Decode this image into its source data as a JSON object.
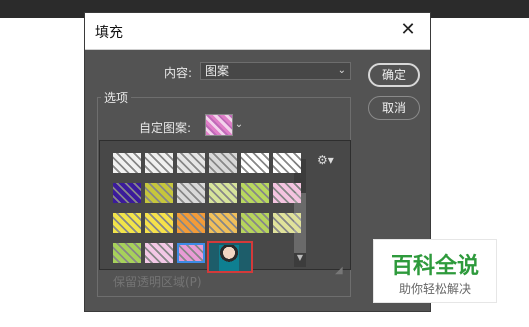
{
  "dialog": {
    "title": "填充",
    "content_label": "内容:",
    "content_value": "图案",
    "ok_label": "确定",
    "cancel_label": "取消",
    "options_title": "选项",
    "custom_pattern_label": "自定图案:",
    "bottom_hint": "保留透明区域(P)"
  },
  "icons": {
    "close": "close-icon",
    "dropdown": "chevron-down-icon",
    "gear": "gear-icon",
    "resize": "resize-grip-icon"
  },
  "patterns": {
    "rows": [
      [
        "#f2f2f2",
        "#f0f0f0",
        "#e6e6e6",
        "#d8d8d8",
        "#ffffff",
        "#ffffff"
      ],
      [
        "#3b1b9b",
        "#c6c63c",
        "#d9d9d9",
        "#d7e49b",
        "#b8d85e",
        "#f4c4e0"
      ],
      [
        "#f2e44a",
        "#f6e14b",
        "#f29b38",
        "#f0c05a",
        "#b6d45c",
        "#e0e29b"
      ],
      [
        "#a7d15a",
        "#f3c8e6",
        "#e89bd6",
        "#2d7c8a"
      ]
    ],
    "selected_index": [
      3,
      2
    ],
    "highlighted_index": [
      3,
      3
    ]
  },
  "watermark": {
    "brand": "百科全说",
    "tagline": "助你轻松解决"
  },
  "colors": {
    "dialog_bg": "#535353",
    "selected_border": "#3d8be6",
    "highlight_border": "#d33a3a",
    "watermark_green": "#2e9a3c"
  }
}
